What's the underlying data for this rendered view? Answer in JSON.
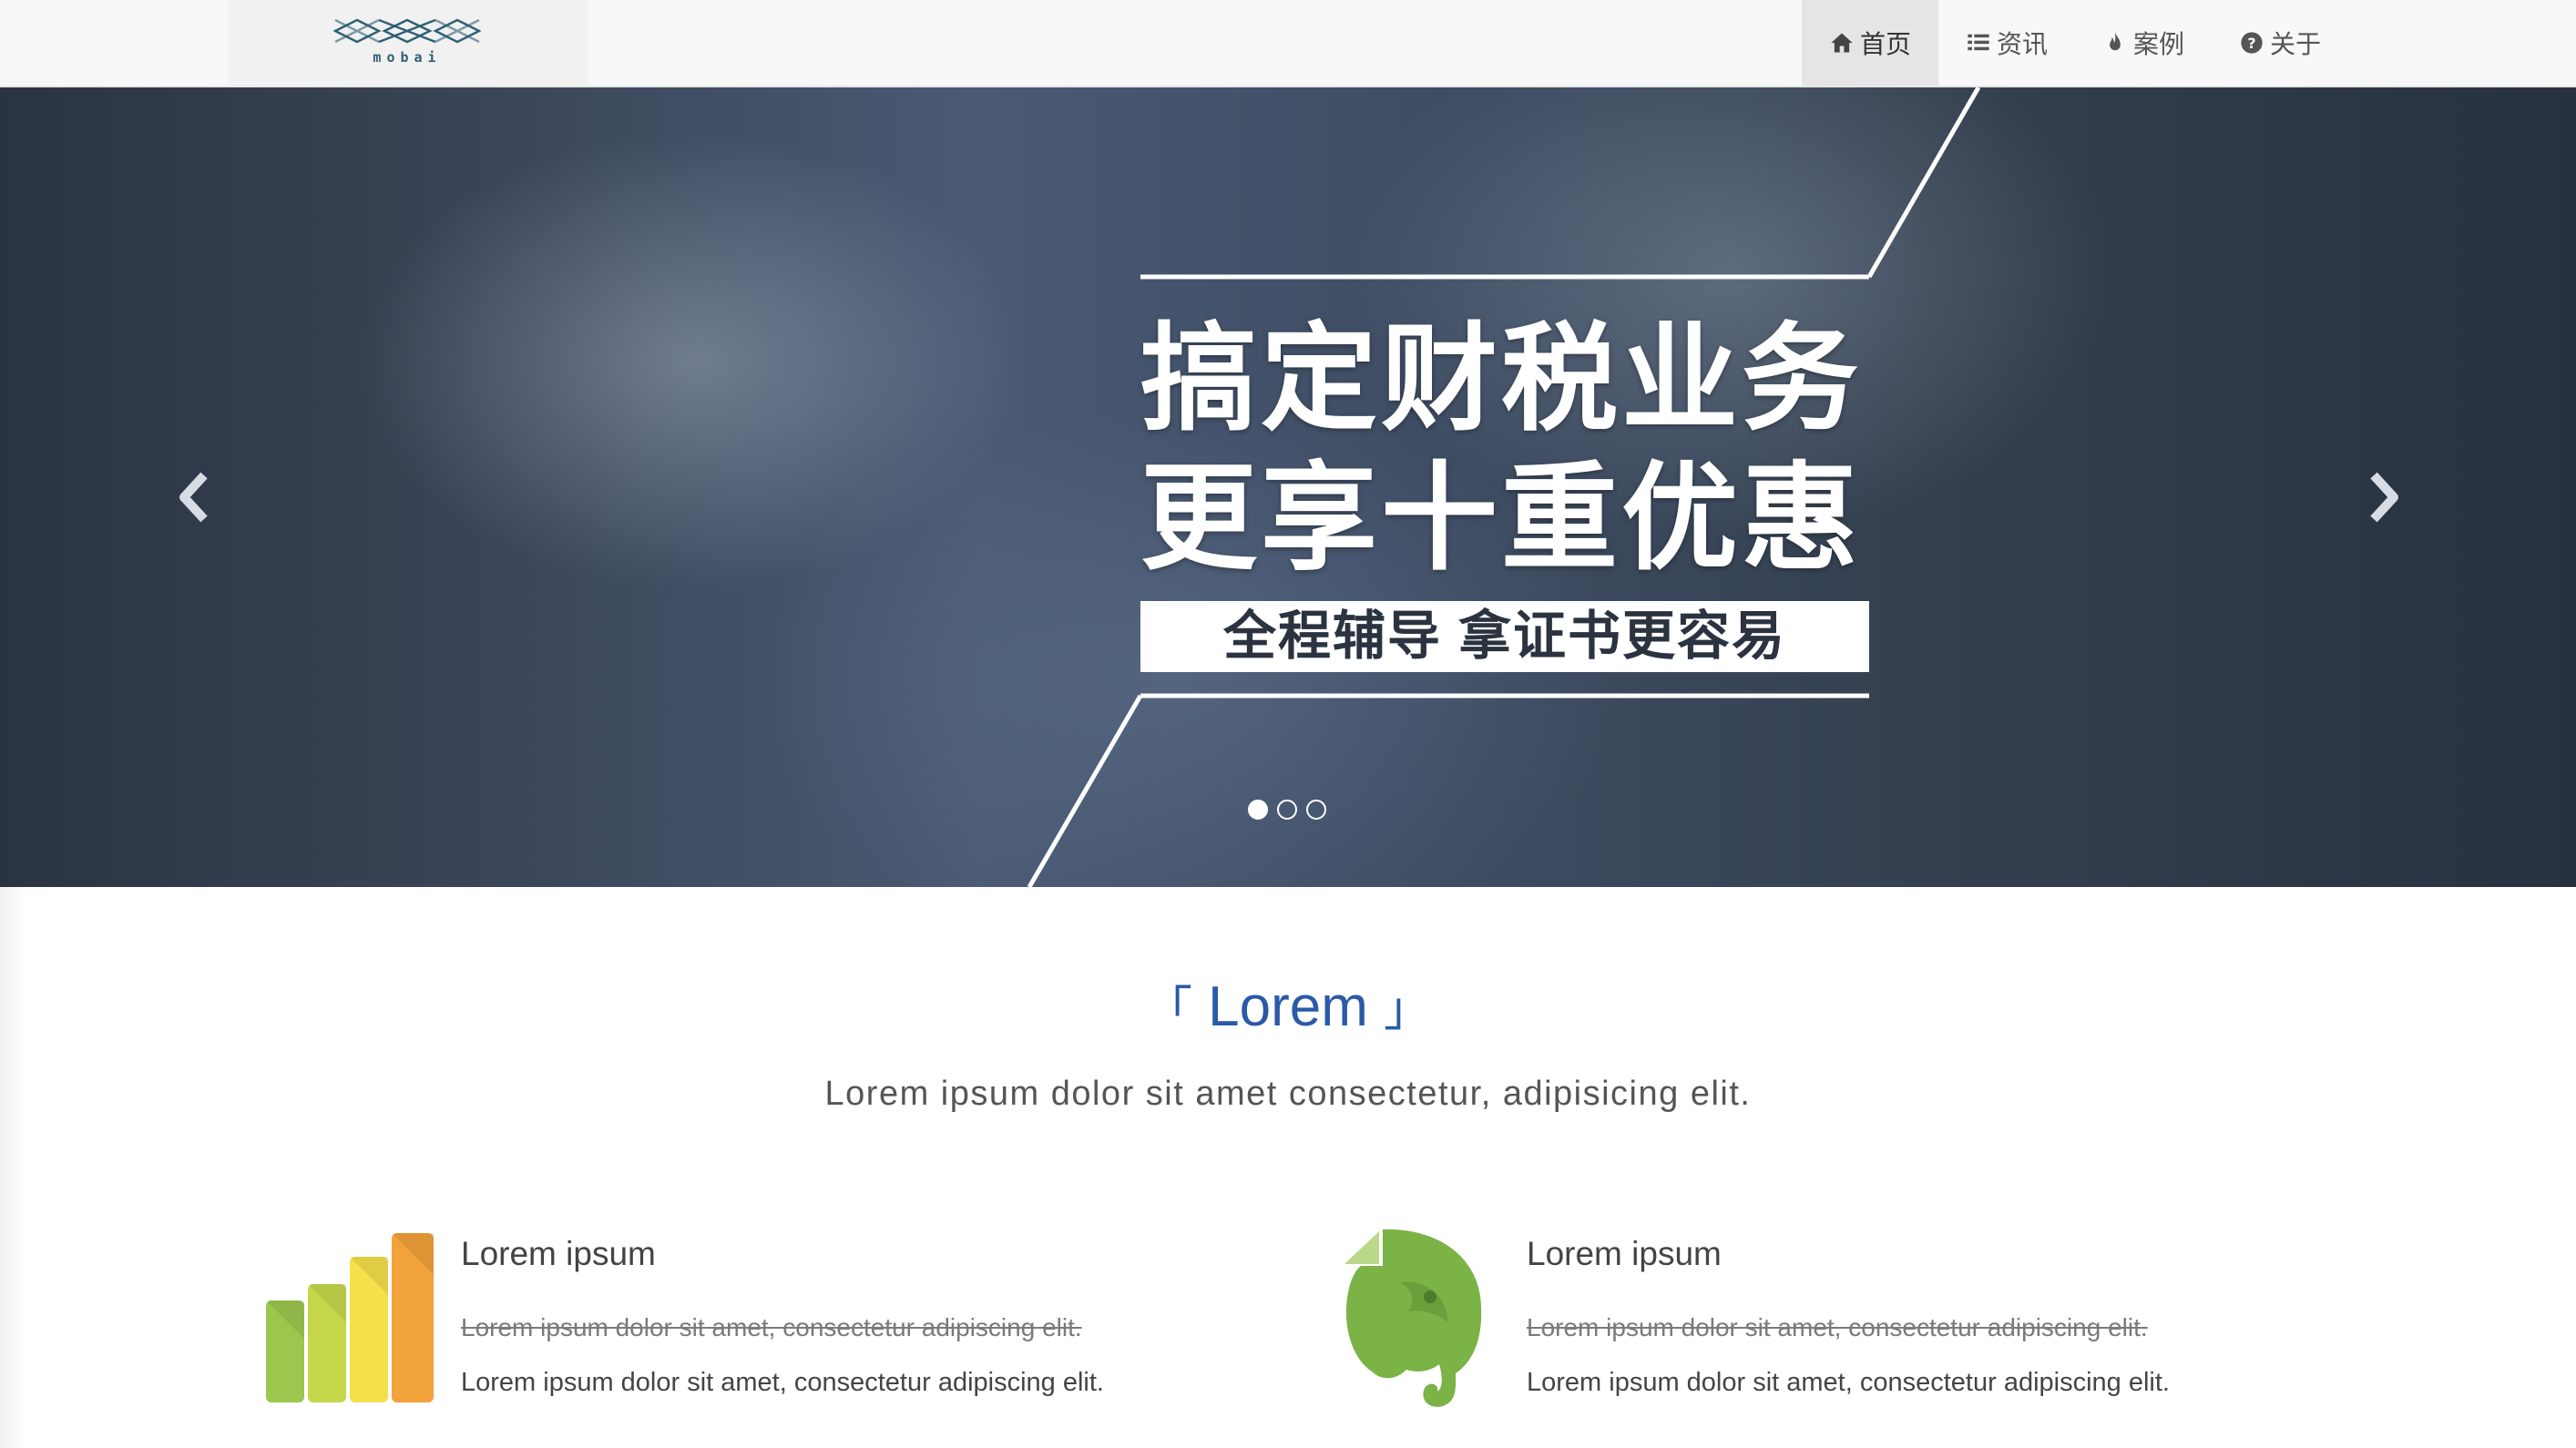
{
  "logo": {
    "text": "mobai",
    "icon": "crossed-arrows-logo"
  },
  "nav": {
    "items": [
      {
        "label": "首页",
        "icon": "home-icon",
        "active": true
      },
      {
        "label": "资讯",
        "icon": "list-icon",
        "active": false
      },
      {
        "label": "案例",
        "icon": "fire-icon",
        "active": false
      },
      {
        "label": "关于",
        "icon": "question-circle-icon",
        "active": false
      }
    ]
  },
  "banner": {
    "line1": "搞定财税业务",
    "line2": "更享十重优惠",
    "subline": "全程辅导 拿证书更容易",
    "prev_icon": "chevron-left-icon",
    "next_icon": "chevron-right-icon",
    "slides_total": 3,
    "active_slide": 1
  },
  "section": {
    "title_open": "「",
    "title": "Lorem",
    "title_close": "」",
    "subtitle": "Lorem ipsum dolor sit amet consectetur, adipisicing elit."
  },
  "features": [
    {
      "icon": "bar-chart-icon",
      "title": "Lorem ipsum",
      "strike_text": "Lorem ipsum dolor sit amet, consectetur adipiscing elit.",
      "description": "Lorem ipsum dolor sit amet, consectetur adipiscing elit."
    },
    {
      "icon": "elephant-icon",
      "title": "Lorem ipsum",
      "strike_text": "Lorem ipsum dolor sit amet, consectetur adipiscing elit.",
      "description": "Lorem ipsum dolor sit amet, consectetur adipiscing elit."
    }
  ],
  "colors": {
    "accent": "#2a5aa8",
    "nav_bg": "#f8f8f8",
    "nav_active_bg": "#e5e5e5",
    "banner_dark": "#2a3341"
  }
}
